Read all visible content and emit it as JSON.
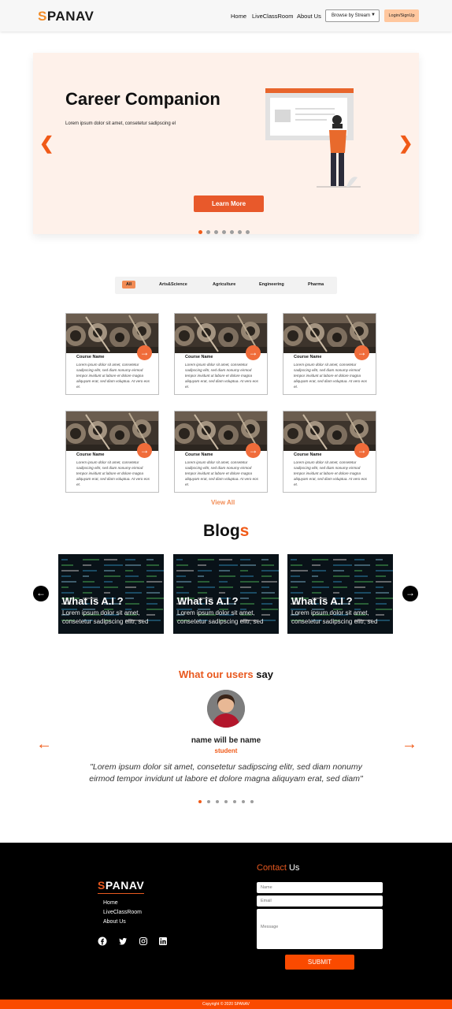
{
  "header": {
    "logo_first": "S",
    "logo_rest": "PANAV",
    "nav": [
      "Home",
      "LiveClassRoom",
      "About Us"
    ],
    "browse_label": "Browse by Stream",
    "login_label": "Login/SignUp"
  },
  "hero": {
    "title": "Career Companion",
    "subtitle": "Lorem ipsum dolor sit amet, consetetur sadipscing el",
    "button": "Learn More",
    "slide_count": 7,
    "active_slide": 1
  },
  "filters": [
    "All",
    "Arts&Science",
    "Agriculture",
    "Engineering",
    "Pharma"
  ],
  "courses": {
    "title": "Course Name",
    "text": "Lorem ipsum dolor sit amet, consetetur sadipscing elitr, sed diam nonumy eirmod tempor invidunt ut labore et dolore magna aliquyam erat, sed diam voluptua. At vero eos et.",
    "count": 6,
    "view_all": "View All"
  },
  "blogs": {
    "title_main": "Blog",
    "title_accent": "s",
    "items": [
      {
        "title": "What is A.I ?",
        "text": "Lorem ipsum dolor sit amet,\nconsetetur sadipscing elitr, sed"
      },
      {
        "title": "What is A.I ?",
        "text": "Lorem ipsum dolor sit amet,\nconsetetur sadipscing elitr, sed"
      },
      {
        "title": "What is A.I ?",
        "text": "Lorem ipsum dolor sit amet,\nconsetetur sadipscing elitr, sed"
      }
    ]
  },
  "testimonials": {
    "title_accent": "What our users",
    "title_rest": " say",
    "name": "name will be name",
    "role": "student",
    "quote": "\"Lorem ipsum dolor sit amet, consetetur sadipscing elitr, sed diam nonumy eirmod tempor invidunt ut labore et dolore magna aliquyam erat, sed diam\"",
    "dot_count": 7,
    "active_dot": 1
  },
  "footer": {
    "logo_first": "S",
    "logo_rest": "PANAV",
    "links": [
      "Home",
      "LiveClassRoom",
      "About Us"
    ],
    "social": [
      "facebook-icon",
      "twitter-icon",
      "instagram-icon",
      "linkedin-icon"
    ],
    "contact_accent": "Contact",
    "contact_rest": " Us",
    "name_placeholder": "Name",
    "email_placeholder": "Email",
    "message_placeholder": "Message",
    "submit": "SUBMIT",
    "copyright": "Copyright © 2020 SPANAV"
  },
  "colors": {
    "accent": "#f05a18",
    "hero_bg": "#fef1ea",
    "submit": "#fa4a00"
  }
}
